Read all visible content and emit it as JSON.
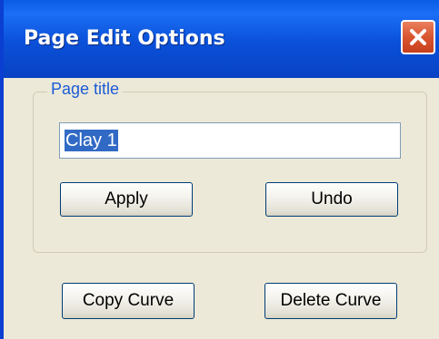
{
  "window": {
    "title": "Page Edit Options",
    "close_icon": "close-x-icon"
  },
  "page_title_group": {
    "label": "Page title",
    "input_value": "Clay 1",
    "input_selected": true,
    "apply_label": "Apply",
    "undo_label": "Undo"
  },
  "actions": {
    "copy_curve_label": "Copy Curve",
    "delete_curve_label": "Delete Curve"
  },
  "colors": {
    "titlebar": "#0a50d8",
    "close_button": "#d9552f",
    "group_label": "#1d5cd6",
    "selection": "#316ac5",
    "dialog_background": "#ece9d8"
  }
}
